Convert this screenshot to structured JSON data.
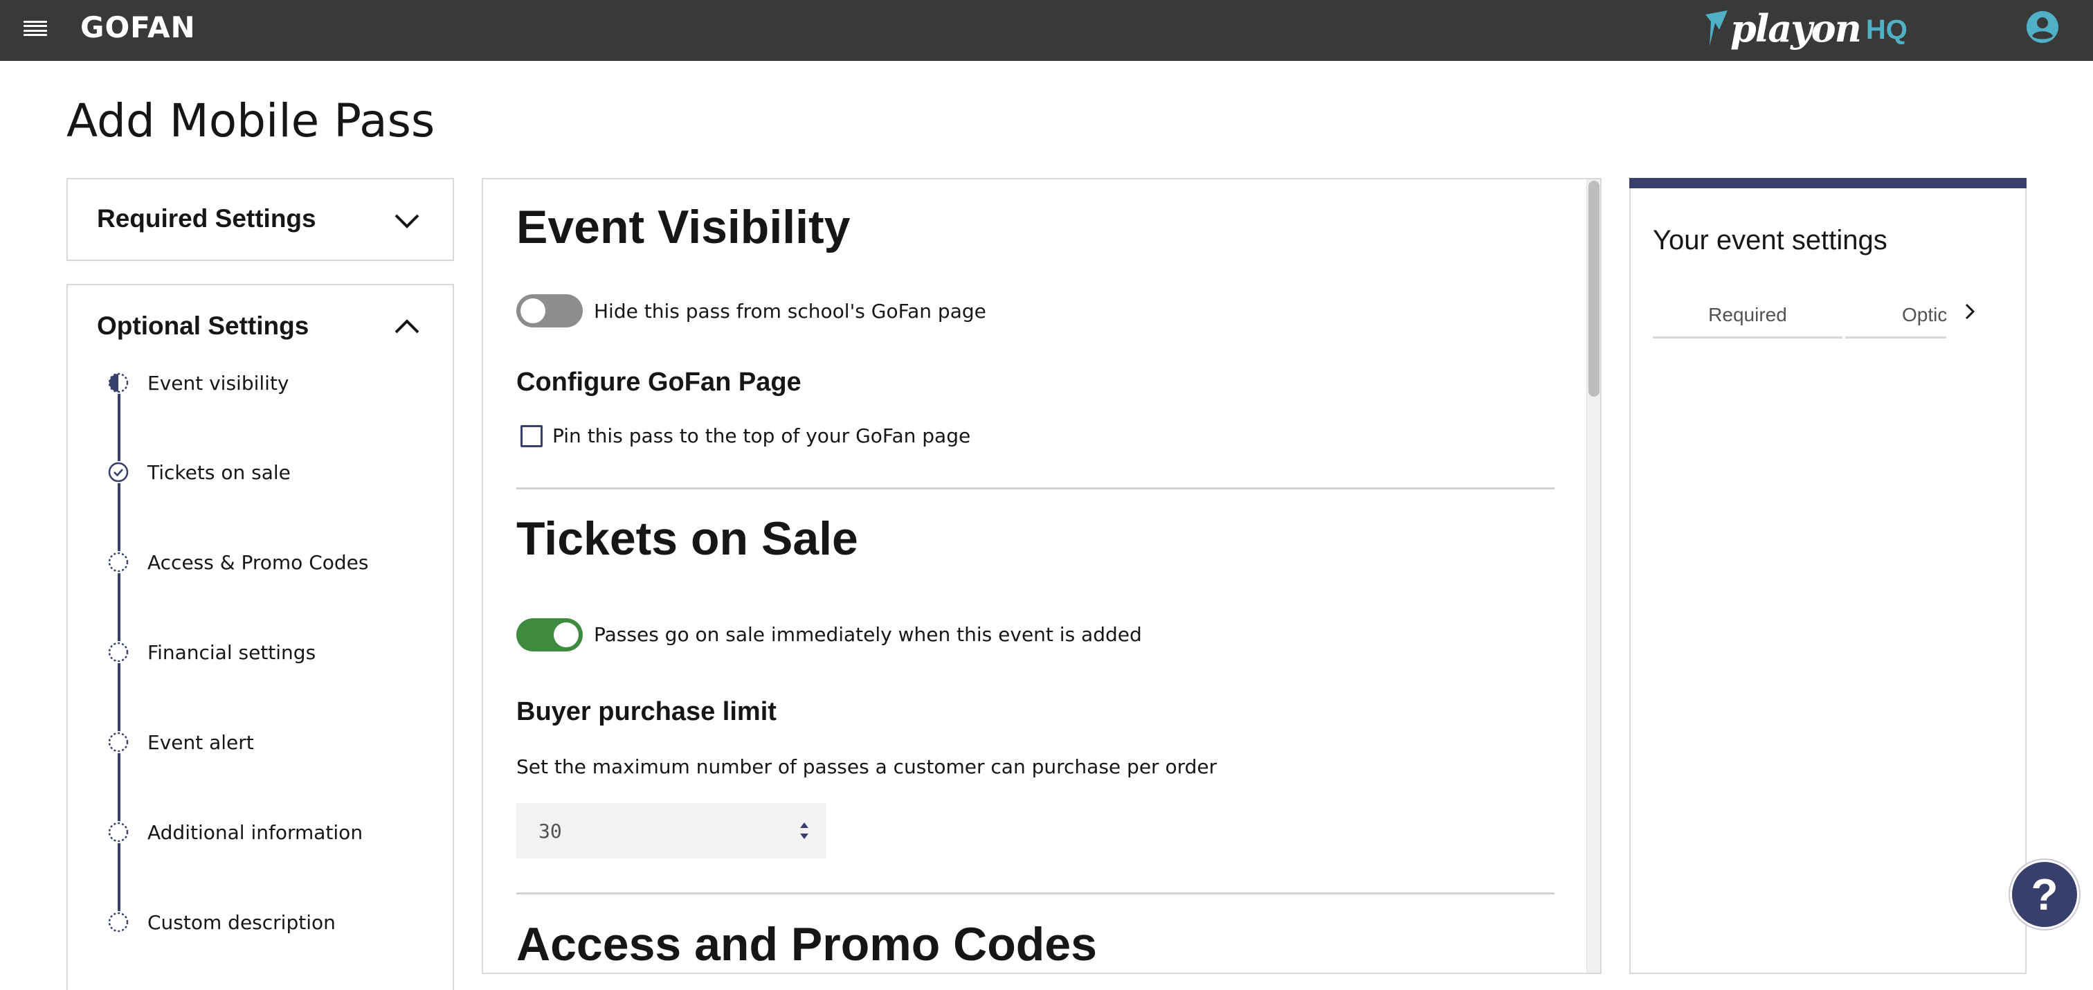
{
  "header": {
    "brand": "GOFAN",
    "partner_logo": {
      "word": "playon",
      "suffix": "HQ"
    },
    "icons": {
      "menu": "hamburger-menu-icon",
      "account": "user-avatar-icon"
    },
    "colors": {
      "bar": "#393939",
      "hq": "#4fb0c6"
    }
  },
  "page": {
    "title": "Add Mobile Pass"
  },
  "sidebar": {
    "required_panel": {
      "title": "Required Settings",
      "expanded": false
    },
    "optional_panel": {
      "title": "Optional Settings",
      "expanded": true,
      "steps": [
        {
          "label": "Event visibility",
          "status": "in-progress"
        },
        {
          "label": "Tickets on sale",
          "status": "complete"
        },
        {
          "label": "Access & Promo Codes",
          "status": "not-started"
        },
        {
          "label": "Financial settings",
          "status": "not-started"
        },
        {
          "label": "Event alert",
          "status": "not-started"
        },
        {
          "label": "Additional information",
          "status": "not-started"
        },
        {
          "label": "Custom description",
          "status": "not-started"
        }
      ]
    }
  },
  "main": {
    "event_visibility": {
      "heading": "Event Visibility",
      "hide_toggle": {
        "label": "Hide this pass from school's GoFan page",
        "on": false
      },
      "configure_heading": "Configure GoFan Page",
      "pin_checkbox": {
        "label": "Pin this pass to the top of your GoFan page",
        "checked": false
      }
    },
    "tickets_on_sale": {
      "heading": "Tickets on Sale",
      "sale_toggle": {
        "label": "Passes go on sale immediately when this event is added",
        "on": true
      },
      "limit_heading": "Buyer purchase limit",
      "limit_help": "Set the maximum number of passes a customer can purchase per order",
      "limit_value": "30"
    },
    "access_promo": {
      "heading": "Access and Promo Codes"
    },
    "colors": {
      "toggle_on": "#3e8a3f",
      "toggle_off": "#8d8d8d",
      "accent": "#393f6b"
    }
  },
  "summary": {
    "title": "Your event settings",
    "tabs": [
      {
        "label": "Required"
      },
      {
        "label": "Optic"
      }
    ]
  },
  "help": {
    "label": "?"
  }
}
